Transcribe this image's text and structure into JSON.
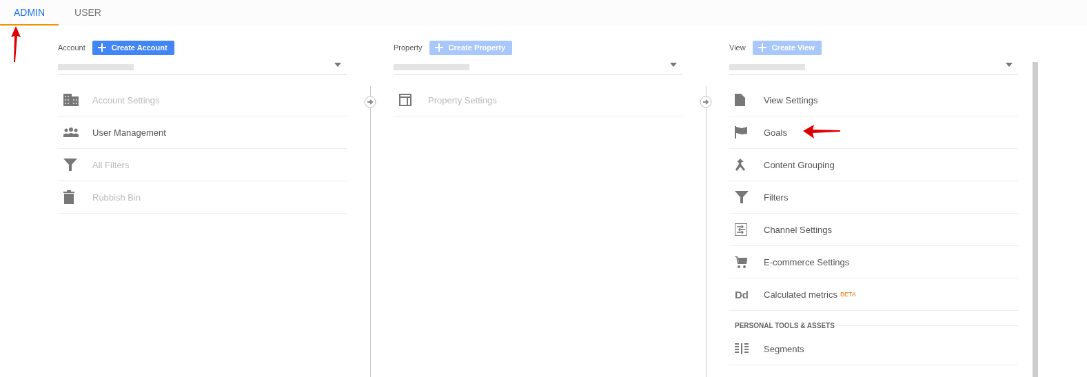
{
  "tabs": [
    {
      "label": "ADMIN",
      "selected": true
    },
    {
      "label": "USER",
      "selected": false
    }
  ],
  "columns": [
    {
      "label": "Account",
      "create_button": {
        "label": "Create Account",
        "disabled": false
      },
      "items": [
        {
          "kind": "building",
          "label": "Account Settings",
          "disabled": true
        },
        {
          "kind": "people",
          "label": "User Management",
          "disabled": false
        },
        {
          "kind": "funnel",
          "label": "All Filters",
          "disabled": true
        },
        {
          "kind": "trash",
          "label": "Rubbish Bin",
          "disabled": true
        }
      ]
    },
    {
      "label": "Property",
      "create_button": {
        "label": "Create Property",
        "disabled": true
      },
      "items": [
        {
          "kind": "layout",
          "label": "Property Settings",
          "disabled": true
        }
      ]
    },
    {
      "label": "View",
      "create_button": {
        "label": "Create View",
        "disabled": true
      },
      "items": [
        {
          "kind": "document",
          "label": "View Settings",
          "disabled": false
        },
        {
          "kind": "flag",
          "label": "Goals",
          "disabled": false
        },
        {
          "kind": "merge",
          "label": "Content Grouping",
          "disabled": false
        },
        {
          "kind": "funnel",
          "label": "Filters",
          "disabled": false
        },
        {
          "kind": "channel",
          "label": "Channel Settings",
          "disabled": false
        },
        {
          "kind": "cart",
          "label": "E-commerce Settings",
          "disabled": false
        },
        {
          "kind": "letters",
          "icon_text": "Dd",
          "label": "Calculated metrics",
          "badge": "BETA",
          "disabled": false
        }
      ],
      "section": {
        "title": "PERSONAL TOOLS & ASSETS",
        "items": [
          {
            "kind": "segments",
            "label": "Segments",
            "disabled": false
          }
        ]
      }
    }
  ]
}
